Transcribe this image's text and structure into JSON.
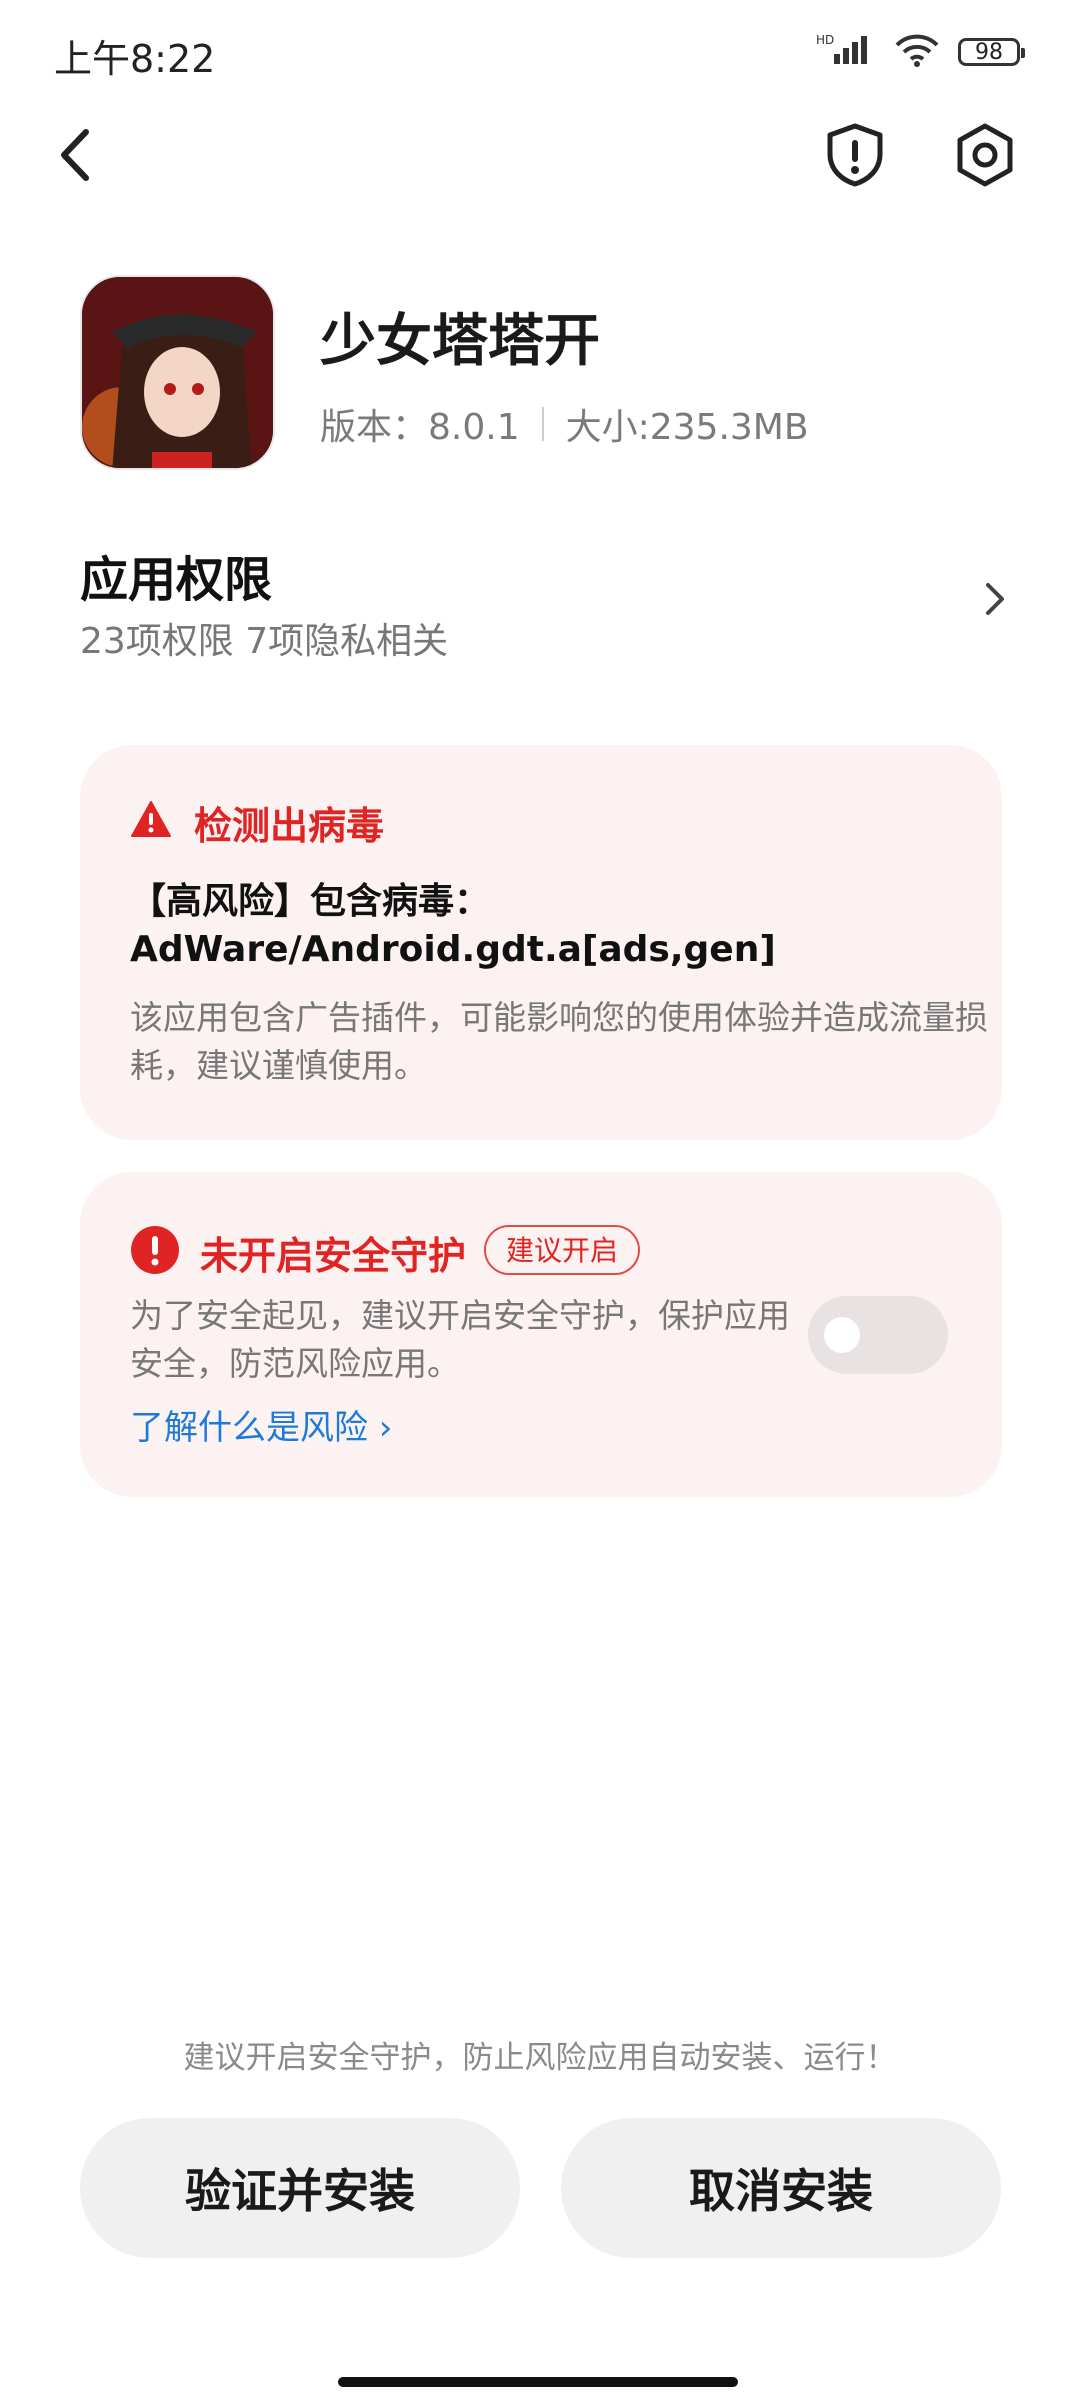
{
  "status_bar": {
    "time": "上午8:22",
    "network_label": "HD",
    "battery": "98"
  },
  "nav": {
    "back_icon": "back-chevron-icon",
    "shield_icon": "shield-alert-icon",
    "settings_icon": "gear-icon"
  },
  "app": {
    "name": "少女塔塔开",
    "version": "版本：8.0.1",
    "size": "大小:235.3MB"
  },
  "permissions": {
    "title": "应用权限",
    "subtitle": "23项权限 7项隐私相关"
  },
  "virus_card": {
    "title": "检测出病毒",
    "virus_name": "【高风险】包含病毒：AdWare/Android.gdt.a[ads,gen]",
    "description": "该应用包含广告插件，可能影响您的使用体验并造成流量损耗，建议谨慎使用。",
    "accent_color": "#e02424"
  },
  "protection_card": {
    "title": "未开启安全守护",
    "badge": "建议开启",
    "description": "为了安全起见，建议开启安全守护，保护应用安全，防范风险应用。",
    "learn_more": "了解什么是风险 ›",
    "toggle_on": false,
    "link_color": "#1e7ad8"
  },
  "footer": {
    "tip": "建议开启安全守护，防止风险应用自动安装、运行！",
    "verify_button": "验证并安装",
    "cancel_button": "取消安装"
  }
}
